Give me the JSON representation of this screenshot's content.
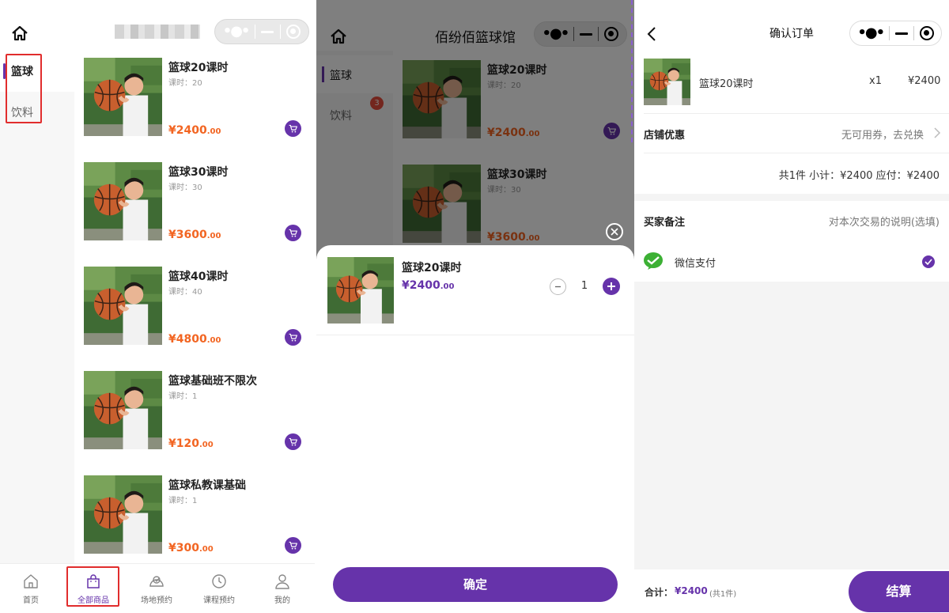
{
  "colors": {
    "accent": "#6633aa",
    "price": "#f26522",
    "highlight": "#e12d2d",
    "badge": "#e74c3c",
    "wechat": "#3cb034"
  },
  "shop": {
    "title": "佰纷佰篮球馆"
  },
  "categories": [
    {
      "label": "篮球",
      "active": true
    },
    {
      "label": "饮料",
      "active": false
    }
  ],
  "products": [
    {
      "name": "篮球20课时",
      "meta": "课时：20",
      "price_int": "¥2400",
      "price_dec": ".00"
    },
    {
      "name": "篮球30课时",
      "meta": "课时：30",
      "price_int": "¥3600",
      "price_dec": ".00"
    },
    {
      "name": "篮球40课时",
      "meta": "课时：40",
      "price_int": "¥4800",
      "price_dec": ".00"
    },
    {
      "name": "篮球基础班不限次",
      "meta": "课时：1",
      "price_int": "¥120",
      "price_dec": ".00"
    },
    {
      "name": "篮球私教课基础",
      "meta": "课时：1",
      "price_int": "¥300",
      "price_dec": ".00"
    }
  ],
  "tabbar": [
    {
      "label": "首页",
      "icon": "home-icon"
    },
    {
      "label": "全部商品",
      "icon": "shopping-bag-icon"
    },
    {
      "label": "场地预约",
      "icon": "venue-icon"
    },
    {
      "label": "课程预约",
      "icon": "clock-icon"
    },
    {
      "label": "我的",
      "icon": "user-icon"
    }
  ],
  "cart_badge": "3",
  "sheet": {
    "name": "篮球20课时",
    "price_int": "¥2400",
    "price_dec": ".00",
    "qty": "1",
    "confirm_label": "确定"
  },
  "order": {
    "title": "确认订单",
    "item_name": "篮球20课时",
    "item_qty": "x1",
    "item_price": "¥2400",
    "coupon_label": "店铺优惠",
    "coupon_value": "无可用券，去兑换",
    "summary": "共1件 小计：¥2400 应付：¥2400",
    "note_label": "买家备注",
    "note_placeholder": "对本次交易的说明(选填)",
    "pay_method": "微信支付",
    "total_label": "合计：",
    "total_value": "¥2400",
    "total_count": "(共1件)",
    "checkout_label": "结算"
  }
}
